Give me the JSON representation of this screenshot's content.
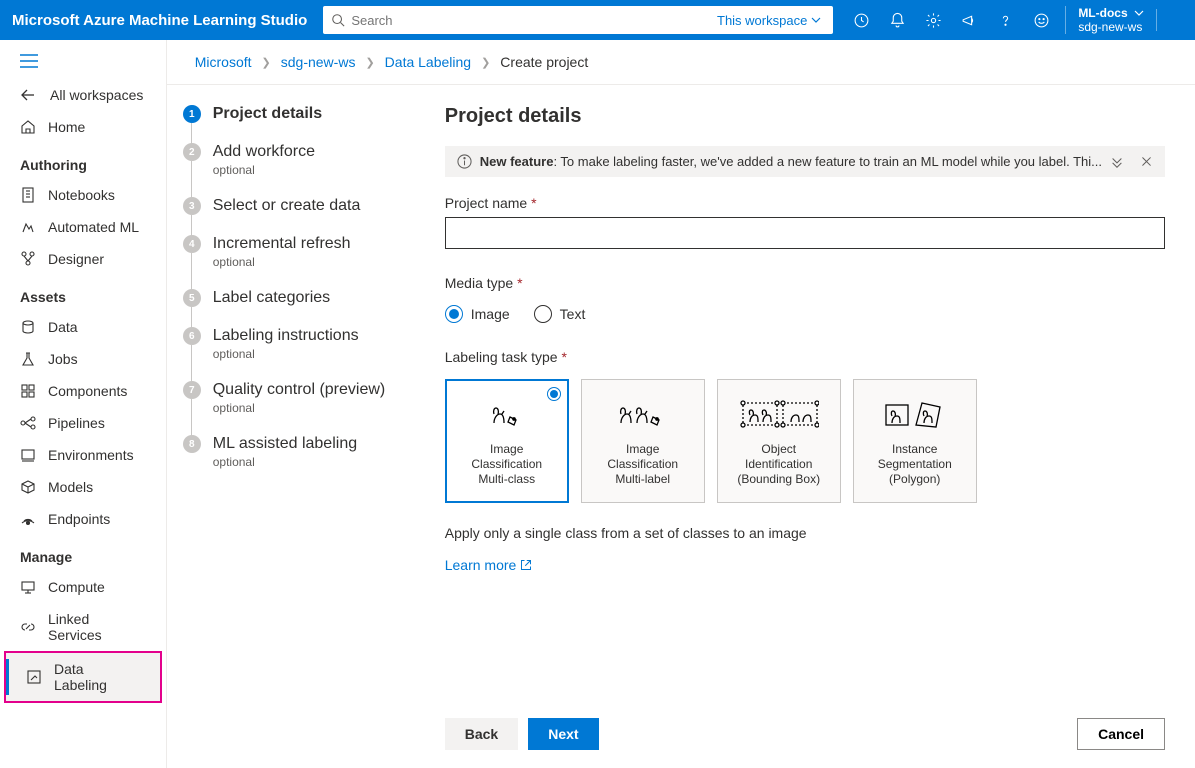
{
  "header": {
    "app_title": "Microsoft Azure Machine Learning Studio",
    "search_placeholder": "Search",
    "scope_label": "This workspace",
    "account_dir": "ML-docs",
    "account_ws": "sdg-new-ws"
  },
  "sidebar": {
    "all_workspaces": "All workspaces",
    "home": "Home",
    "sections": {
      "authoring": "Authoring",
      "assets": "Assets",
      "manage": "Manage"
    },
    "items": {
      "notebooks": "Notebooks",
      "automl": "Automated ML",
      "designer": "Designer",
      "data": "Data",
      "jobs": "Jobs",
      "components": "Components",
      "pipelines": "Pipelines",
      "environments": "Environments",
      "models": "Models",
      "endpoints": "Endpoints",
      "compute": "Compute",
      "linked": "Linked Services",
      "data_labeling": "Data Labeling"
    }
  },
  "breadcrumb": {
    "b1": "Microsoft",
    "b2": "sdg-new-ws",
    "b3": "Data Labeling",
    "b4": "Create project"
  },
  "steps": [
    {
      "title": "Project details",
      "sub": ""
    },
    {
      "title": "Add workforce",
      "sub": "optional"
    },
    {
      "title": "Select or create data",
      "sub": ""
    },
    {
      "title": "Incremental refresh",
      "sub": "optional"
    },
    {
      "title": "Label categories",
      "sub": ""
    },
    {
      "title": "Labeling instructions",
      "sub": "optional"
    },
    {
      "title": "Quality control (preview)",
      "sub": "optional"
    },
    {
      "title": "ML assisted labeling",
      "sub": "optional"
    }
  ],
  "form": {
    "title": "Project details",
    "banner_bold": "New feature",
    "banner_text": ": To make labeling faster, we've added a new feature to train an ML model while you label. Thi...",
    "project_name_label": "Project name",
    "media_type_label": "Media type",
    "media_image": "Image",
    "media_text": "Text",
    "task_type_label": "Labeling task type",
    "cards": [
      {
        "l1": "Image",
        "l2": "Classification",
        "l3": "Multi-class"
      },
      {
        "l1": "Image",
        "l2": "Classification",
        "l3": "Multi-label"
      },
      {
        "l1": "Object",
        "l2": "Identification",
        "l3": "(Bounding Box)"
      },
      {
        "l1": "Instance",
        "l2": "Segmentation",
        "l3": "(Polygon)"
      }
    ],
    "description": "Apply only a single class from a set of classes to an image",
    "learn_more": "Learn more"
  },
  "footer": {
    "back": "Back",
    "next": "Next",
    "cancel": "Cancel"
  }
}
